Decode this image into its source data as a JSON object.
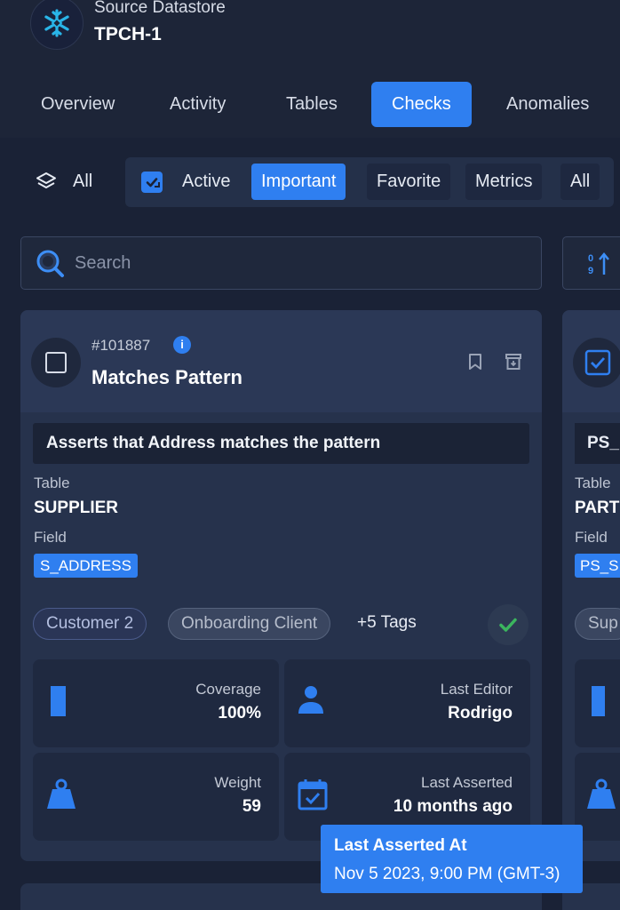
{
  "header": {
    "datastore_label": "Source Datastore",
    "datastore_name": "TPCH-1",
    "logo_icon": "snowflake-icon"
  },
  "tabs": [
    {
      "label": "Overview",
      "active": false
    },
    {
      "label": "Activity",
      "active": false
    },
    {
      "label": "Tables",
      "active": false
    },
    {
      "label": "Checks",
      "active": true
    },
    {
      "label": "Anomalies",
      "active": false
    }
  ],
  "filters": {
    "scope_label": "All",
    "status_label": "Active",
    "chips": [
      "Important",
      "Favorite",
      "Metrics",
      "All"
    ],
    "selected": "Important"
  },
  "search": {
    "placeholder": "Search",
    "value": ""
  },
  "check_card": {
    "id": "#101887",
    "title": "Matches Pattern",
    "description": "Asserts that Address matches the pattern",
    "table_label": "Table",
    "table": "SUPPLIER",
    "field_label": "Field",
    "field": "S_ADDRESS",
    "tags": [
      "Customer 2",
      "Onboarding Client"
    ],
    "more_tags": "+5 Tags",
    "stats": {
      "coverage_label": "Coverage",
      "coverage": "100%",
      "editor_label": "Last Editor",
      "editor": "Rodrigo",
      "weight_label": "Weight",
      "weight": "59",
      "asserted_label": "Last Asserted",
      "asserted": "10 months ago"
    }
  },
  "second_card": {
    "description": "PS_",
    "table_label": "Table",
    "table": "PART",
    "field_label": "Field",
    "field": "PS_S",
    "tag": "Sup"
  },
  "tooltip": {
    "title": "Last Asserted At",
    "value": "Nov 5 2023, 9:00 PM (GMT-3)"
  },
  "colors": {
    "background": "#1a2236",
    "accent": "#2f7ff0",
    "card": "#26324c",
    "success": "#3bb55e"
  }
}
